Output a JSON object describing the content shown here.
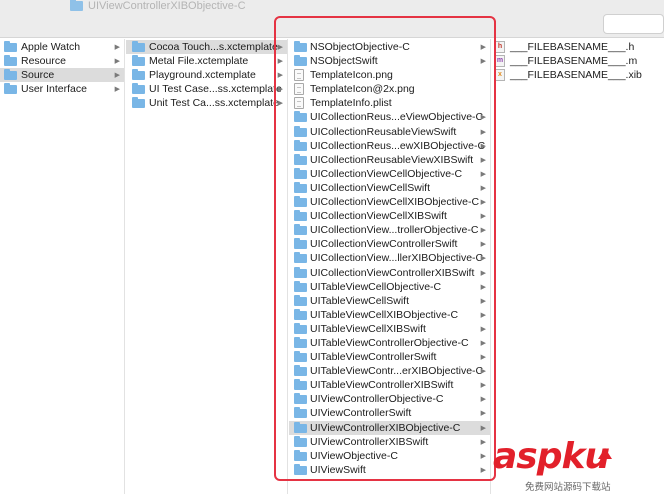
{
  "window": {
    "title": "UIViewControllerXIBObjective-C"
  },
  "col1": {
    "items": [
      {
        "label": "Apple Watch",
        "selected": false
      },
      {
        "label": "Resource",
        "selected": false
      },
      {
        "label": "Source",
        "selected": true
      },
      {
        "label": "User Interface",
        "selected": false
      }
    ]
  },
  "col2": {
    "items": [
      {
        "label": "Cocoa Touch...s.xctemplate",
        "selected": true
      },
      {
        "label": "Metal File.xctemplate",
        "selected": false
      },
      {
        "label": "Playground.xctemplate",
        "selected": false
      },
      {
        "label": "UI Test Case...ss.xctemplate",
        "selected": false
      },
      {
        "label": "Unit Test Ca...ss.xctemplate",
        "selected": false
      }
    ]
  },
  "col3": {
    "items": [
      {
        "label": "NSObjectObjective-C",
        "icon": "folder",
        "arrow": true,
        "selected": false
      },
      {
        "label": "NSObjectSwift",
        "icon": "folder",
        "arrow": true,
        "selected": false
      },
      {
        "label": "TemplateIcon.png",
        "icon": "file",
        "arrow": false,
        "selected": false
      },
      {
        "label": "TemplateIcon@2x.png",
        "icon": "file",
        "arrow": false,
        "selected": false
      },
      {
        "label": "TemplateInfo.plist",
        "icon": "file",
        "arrow": false,
        "selected": false
      },
      {
        "label": "UICollectionReus...eViewObjective-C",
        "icon": "folder",
        "arrow": true,
        "selected": false
      },
      {
        "label": "UICollectionReusableViewSwift",
        "icon": "folder",
        "arrow": true,
        "selected": false
      },
      {
        "label": "UICollectionReus...ewXIBObjective-C",
        "icon": "folder",
        "arrow": true,
        "selected": false
      },
      {
        "label": "UICollectionReusableViewXIBSwift",
        "icon": "folder",
        "arrow": true,
        "selected": false
      },
      {
        "label": "UICollectionViewCellObjective-C",
        "icon": "folder",
        "arrow": true,
        "selected": false
      },
      {
        "label": "UICollectionViewCellSwift",
        "icon": "folder",
        "arrow": true,
        "selected": false
      },
      {
        "label": "UICollectionViewCellXIBObjective-C",
        "icon": "folder",
        "arrow": true,
        "selected": false
      },
      {
        "label": "UICollectionViewCellXIBSwift",
        "icon": "folder",
        "arrow": true,
        "selected": false
      },
      {
        "label": "UICollectionView...trollerObjective-C",
        "icon": "folder",
        "arrow": true,
        "selected": false
      },
      {
        "label": "UICollectionViewControllerSwift",
        "icon": "folder",
        "arrow": true,
        "selected": false
      },
      {
        "label": "UICollectionView...llerXIBObjective-C",
        "icon": "folder",
        "arrow": true,
        "selected": false
      },
      {
        "label": "UICollectionViewControllerXIBSwift",
        "icon": "folder",
        "arrow": true,
        "selected": false
      },
      {
        "label": "UITableViewCellObjective-C",
        "icon": "folder",
        "arrow": true,
        "selected": false
      },
      {
        "label": "UITableViewCellSwift",
        "icon": "folder",
        "arrow": true,
        "selected": false
      },
      {
        "label": "UITableViewCellXIBObjective-C",
        "icon": "folder",
        "arrow": true,
        "selected": false
      },
      {
        "label": "UITableViewCellXIBSwift",
        "icon": "folder",
        "arrow": true,
        "selected": false
      },
      {
        "label": "UITableViewControllerObjective-C",
        "icon": "folder",
        "arrow": true,
        "selected": false
      },
      {
        "label": "UITableViewControllerSwift",
        "icon": "folder",
        "arrow": true,
        "selected": false
      },
      {
        "label": "UITableViewContr...erXIBObjective-C",
        "icon": "folder",
        "arrow": true,
        "selected": false
      },
      {
        "label": "UITableViewControllerXIBSwift",
        "icon": "folder",
        "arrow": true,
        "selected": false
      },
      {
        "label": "UIViewControllerObjective-C",
        "icon": "folder",
        "arrow": true,
        "selected": false
      },
      {
        "label": "UIViewControllerSwift",
        "icon": "folder",
        "arrow": true,
        "selected": false
      },
      {
        "label": "UIViewControllerXIBObjective-C",
        "icon": "folder",
        "arrow": true,
        "selected": true
      },
      {
        "label": "UIViewControllerXIBSwift",
        "icon": "folder",
        "arrow": true,
        "selected": false
      },
      {
        "label": "UIViewObjective-C",
        "icon": "folder",
        "arrow": true,
        "selected": false
      },
      {
        "label": "UIViewSwift",
        "icon": "folder",
        "arrow": true,
        "selected": false
      }
    ]
  },
  "col4": {
    "items": [
      {
        "label": "___FILEBASENAME___.h",
        "badge": "h",
        "badge_color": "#c0392b"
      },
      {
        "label": "___FILEBASENAME___.m",
        "badge": "m",
        "badge_color": "#8e44ad"
      },
      {
        "label": "___FILEBASENAME___.xib",
        "badge": "x",
        "badge_color": "#e08a1e"
      }
    ]
  },
  "watermark": {
    "logo": "aspku",
    "sub": "免费网站源码下载站"
  },
  "colors": {
    "accent_border": "#e53343",
    "folder": "#79b6e6",
    "selection": "#dcdcdc"
  },
  "icons": {
    "folder": "folder-icon",
    "file": "file-icon",
    "arrow": "chevron-right-icon"
  }
}
